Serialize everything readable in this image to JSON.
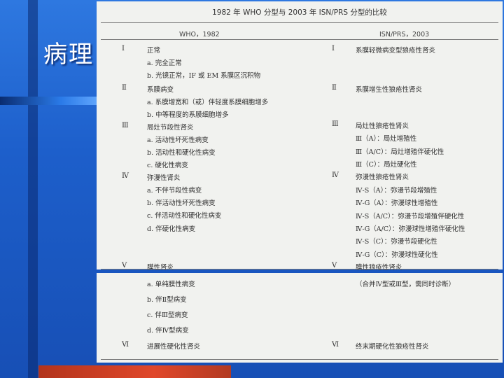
{
  "slide": {
    "title": "病理"
  },
  "table": {
    "title": "1982 年 WHO 分型与 2003 年 ISN/PRS 分型的比较",
    "header_left": "WHO，1982",
    "header_right": "ISN/PRS，2003",
    "left_rows": [
      {
        "num": "Ⅰ",
        "text": "正常"
      },
      {
        "sub": "a. 完全正常"
      },
      {
        "sub": "b. 光镜正常，IF 或 EM 系膜区沉积物"
      },
      {
        "num": "Ⅱ",
        "text": "系膜病变"
      },
      {
        "sub": "a. 系膜增宽和（或）伴轻度系膜细胞增多"
      },
      {
        "sub": "b. 中等程度的系膜细胞增多"
      },
      {
        "num": "Ⅲ",
        "text": "局灶节段性肾炎"
      },
      {
        "sub": "a. 活动性坏死性病变"
      },
      {
        "sub": "b. 活动性和硬化性病变"
      },
      {
        "sub": "c. 硬化性病变"
      },
      {
        "num": "Ⅳ",
        "text": "弥漫性肾炎"
      },
      {
        "sub": "a. 不伴节段性病变"
      },
      {
        "sub": "b. 伴活动性坏死性病变"
      },
      {
        "sub": "c. 伴活动性和硬化性病变"
      },
      {
        "sub": "d. 伴硬化性病变"
      },
      {
        "num": "Ⅴ",
        "text": "膜性肾炎"
      }
    ],
    "right_rows": [
      {
        "num": "Ⅰ",
        "text": "系膜轻微病变型狼疮性肾炎"
      },
      {
        "num": "Ⅱ",
        "text": "系膜增生性狼疮性肾炎"
      },
      {
        "num": "Ⅲ",
        "text": "局灶性狼疮性肾炎"
      },
      {
        "sub": "Ⅲ（A）：局灶增殖性"
      },
      {
        "sub": "Ⅲ（A/C）：局灶增殖伴硬化性"
      },
      {
        "sub": "Ⅲ（C）：局灶硬化性"
      },
      {
        "num": "Ⅳ",
        "text": "弥漫性狼疮性肾炎"
      },
      {
        "sub": "Ⅳ-S（A）：弥漫节段增殖性"
      },
      {
        "sub": "Ⅳ-G（A）：弥漫球性增殖性"
      },
      {
        "sub": "Ⅳ-S（A/C）：弥漫节段增殖伴硬化性"
      },
      {
        "sub": "Ⅳ-G（A/C）：弥漫球性增殖伴硬化性"
      },
      {
        "sub": "Ⅳ-S（C）：弥漫节段硬化性"
      },
      {
        "sub": "Ⅳ-G（C）：弥漫球性硬化性"
      },
      {
        "num": "Ⅴ",
        "text": "膜性狼疮性肾炎"
      }
    ],
    "lower_left": [
      {
        "sub": "a. 单纯膜性病变"
      },
      {
        "sub": "b. 伴Ⅱ型病变"
      },
      {
        "sub": "c. 伴Ⅲ型病变"
      },
      {
        "sub": "d. 伴Ⅳ型病变"
      },
      {
        "num": "Ⅵ",
        "text": "进展性硬化性肾炎"
      }
    ],
    "lower_right": [
      {
        "sub": "（合并Ⅳ型或Ⅲ型，需同时诊断）"
      },
      {
        "num": "Ⅵ",
        "text": "终末期硬化性狼疮性肾炎"
      }
    ]
  }
}
